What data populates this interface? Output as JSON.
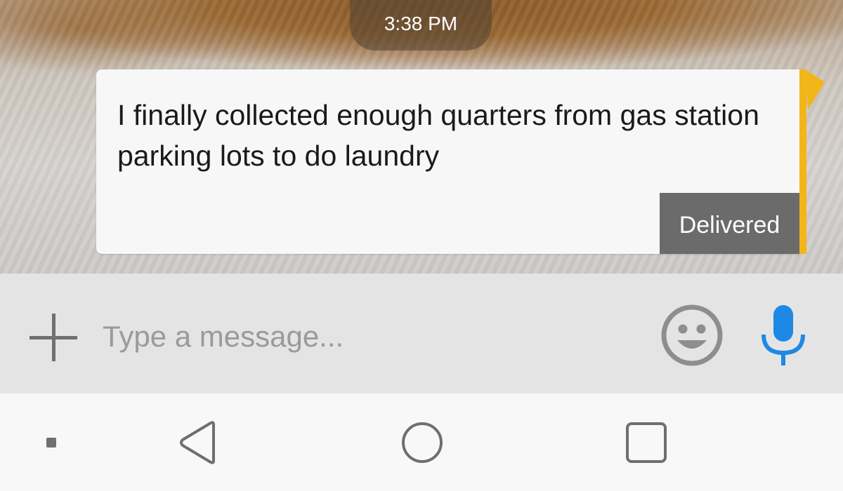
{
  "chat": {
    "timestamp": "3:38 PM",
    "message": {
      "text": "I finally collected enough quarters from gas station parking lots to do laundry",
      "status": "Delivered",
      "accent_color": "#f2b51a"
    }
  },
  "composer": {
    "placeholder": "Type a message...",
    "value": "",
    "icons": {
      "attach": "plus-icon",
      "emoji": "smiley-face-icon",
      "voice": "microphone-icon"
    },
    "mic_color": "#1e88e5"
  },
  "navigation": {
    "icons": [
      "menu-dot-icon",
      "back-triangle-icon",
      "home-circle-icon",
      "recents-square-icon"
    ]
  }
}
